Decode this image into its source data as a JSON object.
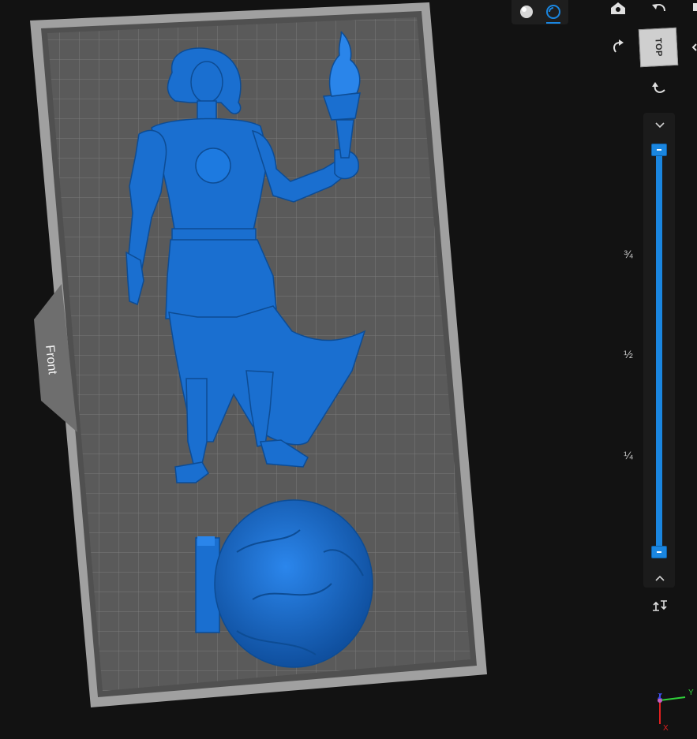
{
  "view_modes": [
    {
      "name": "solid",
      "icon": "solid-sphere-icon",
      "active": false
    },
    {
      "name": "xray",
      "icon": "xray-sphere-icon",
      "active": true
    }
  ],
  "camera_controls": {
    "home_icon": "home-view-icon",
    "rotate_left_icon": "rotate-left-icon",
    "rotate_right_icon": "rotate-right-icon",
    "rotate_down_icon": "rotate-down-icon",
    "view_cube_label": "TOP"
  },
  "build_plate": {
    "front_label": "Front"
  },
  "layer_slider": {
    "ticks": [
      "¾",
      "½",
      "¼"
    ],
    "upper_value": 1.0,
    "lower_value": 0.0,
    "accent_color": "#1a86e0"
  },
  "axes": {
    "x_label": "X",
    "y_label": "Y",
    "z_label": "Z"
  },
  "colors": {
    "background": "#121212",
    "model": "#1a6fd0",
    "plate": "#5a5a5a",
    "plate_border": "#9c9c9c"
  }
}
